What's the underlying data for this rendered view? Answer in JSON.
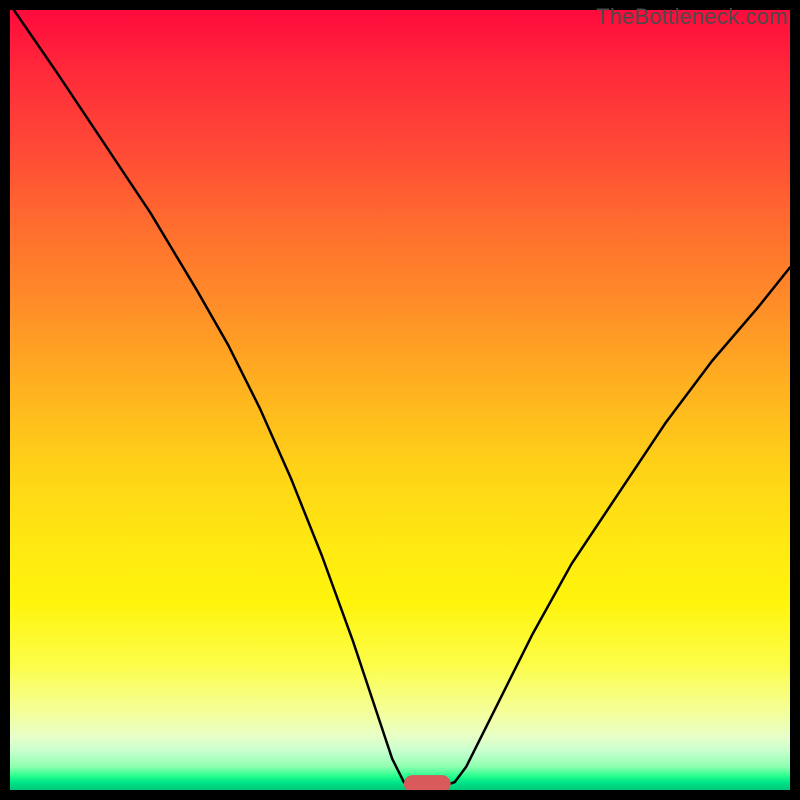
{
  "watermark": "TheBottleneck.com",
  "chart_data": {
    "type": "line",
    "title": "",
    "xlabel": "",
    "ylabel": "",
    "xlim": [
      0,
      100
    ],
    "ylim": [
      0,
      100
    ],
    "grid": false,
    "legend": false,
    "background_gradient": {
      "direction": "vertical",
      "stops": [
        {
          "pos": 0,
          "color": "#ff0a3c"
        },
        {
          "pos": 50,
          "color": "#ffc81a"
        },
        {
          "pos": 85,
          "color": "#fff40c"
        },
        {
          "pos": 100,
          "color": "#00c87a"
        }
      ]
    },
    "series": [
      {
        "name": "bottleneck-curve",
        "color": "#000000",
        "x": [
          0.5,
          6,
          12,
          18,
          24,
          28,
          32,
          36,
          40,
          44,
          47,
          49,
          50.5,
          51.5,
          55.5,
          57,
          58.5,
          60.5,
          63,
          67,
          72,
          78,
          84,
          90,
          96,
          100
        ],
        "y": [
          100,
          92,
          83,
          74,
          64,
          57,
          49,
          40,
          30,
          19,
          10,
          4,
          1,
          0.5,
          0.5,
          1,
          3,
          7,
          12,
          20,
          29,
          38,
          47,
          55,
          62,
          67
        ]
      }
    ],
    "marker": {
      "name": "optimal-point",
      "shape": "capsule",
      "color": "#d85a5a",
      "x_center": 53.5,
      "width_pct": 6,
      "y": 0.8,
      "height_pct": 2.2
    }
  }
}
